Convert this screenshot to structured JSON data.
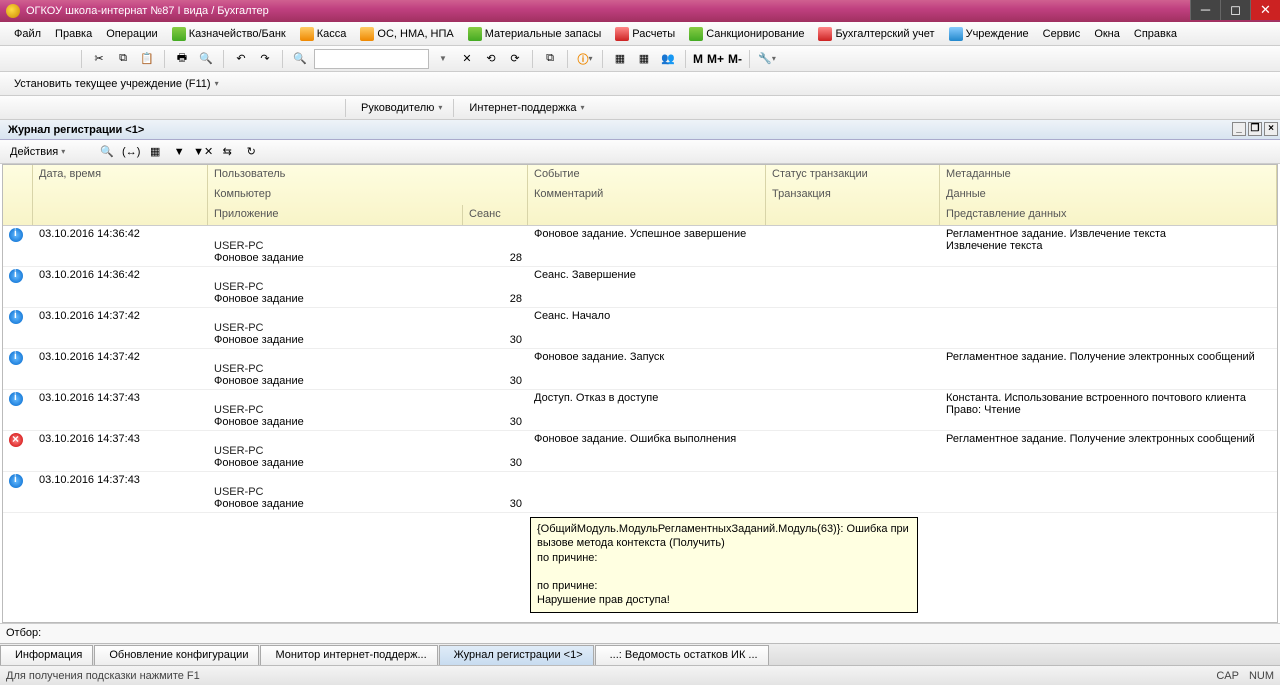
{
  "window": {
    "title": "ОГКОУ школа-интернат №87 I вида / Бухгалтер"
  },
  "menu": {
    "file": "Файл",
    "edit": "Правка",
    "ops": "Операции",
    "treasury": "Казначейство/Банк",
    "cash": "Касса",
    "os": "ОС, НМА, НПА",
    "materials": "Материальные запасы",
    "calc": "Расчеты",
    "sanction": "Санкционирование",
    "accounting": "Бухгалтерский учет",
    "org": "Учреждение",
    "service": "Сервис",
    "windows": "Окна",
    "help": "Справка"
  },
  "sub1": {
    "set_org": "Установить текущее учреждение (F11)"
  },
  "sub2": {
    "manager": "Руководителю",
    "support": "Интернет-поддержка"
  },
  "tb": {
    "m": "М",
    "mplus": "М+",
    "mminus": "М-"
  },
  "doc": {
    "title": "Журнал регистрации <1>"
  },
  "actions": {
    "label": "Действия"
  },
  "headers": {
    "date": "Дата, время",
    "user": "Пользователь",
    "event": "Событие",
    "trans_status": "Статус транзакции",
    "meta": "Метаданные",
    "computer": "Компьютер",
    "comment": "Комментарий",
    "trans": "Транзакция",
    "data": "Данные",
    "app": "Приложение",
    "session": "Сеанс",
    "data_view": "Представление данных"
  },
  "rows": [
    {
      "icon": "info",
      "date": "03.10.2016 14:36:42",
      "pc": "USER-PC",
      "app": "Фоновое задание",
      "sess": "28",
      "event": "Фоновое задание. Успешное завершение",
      "meta": "Регламентное задание. Извлечение текста",
      "data": "Извлечение текста"
    },
    {
      "icon": "info",
      "date": "03.10.2016 14:36:42",
      "pc": "USER-PC",
      "app": "Фоновое задание",
      "sess": "28",
      "event": "Сеанс. Завершение",
      "meta": "",
      "data": ""
    },
    {
      "icon": "info",
      "date": "03.10.2016 14:37:42",
      "pc": "USER-PC",
      "app": "Фоновое задание",
      "sess": "30",
      "event": "Сеанс. Начало",
      "meta": "",
      "data": ""
    },
    {
      "icon": "info",
      "date": "03.10.2016 14:37:42",
      "pc": "USER-PC",
      "app": "Фоновое задание",
      "sess": "30",
      "event": "Фоновое задание. Запуск",
      "meta": "Регламентное задание. Получение электронных сообщений",
      "data": ""
    },
    {
      "icon": "info",
      "date": "03.10.2016 14:37:43",
      "pc": "USER-PC",
      "app": "Фоновое задание",
      "sess": "30",
      "event": "Доступ. Отказ в доступе",
      "meta": "Константа. Использование встроенного почтового клиента",
      "data": "Право: Чтение"
    },
    {
      "icon": "err",
      "date": "03.10.2016 14:37:43",
      "pc": "USER-PC",
      "app": "Фоновое задание",
      "sess": "30",
      "event": "Фоновое задание. Ошибка выполнения",
      "meta": "Регламентное задание. Получение электронных сообщений",
      "data": ""
    },
    {
      "icon": "info",
      "date": "03.10.2016 14:37:43",
      "pc": "USER-PC",
      "app": "Фоновое задание",
      "sess": "30",
      "event": "",
      "meta": "",
      "data": ""
    }
  ],
  "tooltip": "{ОбщийМодуль.МодульРегламентныхЗаданий.Модуль(63)}: Ошибка при вызове метода контекста (Получить)\nпо причине:\n\nпо причине:\nНарушение прав доступа!",
  "filter": "Отбор:",
  "tabs": {
    "info": "Информация",
    "update": "Обновление конфигурации",
    "monitor": "Монитор интернет-поддерж...",
    "journal": "Журнал регистрации <1>",
    "balance": "...: Ведомость остатков ИК ..."
  },
  "status": {
    "hint": "Для получения подсказки нажмите F1",
    "cap": "CAP",
    "num": "NUM"
  }
}
